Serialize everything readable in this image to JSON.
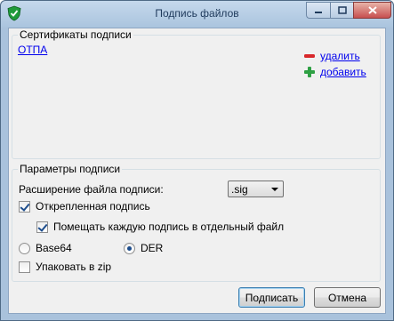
{
  "window": {
    "title": "Подпись файлов"
  },
  "certificates": {
    "legend": "Сертификаты подписи",
    "items": [
      "ОТПА"
    ],
    "remove_label": "удалить",
    "add_label": "добавить"
  },
  "params": {
    "legend": "Параметры подписи",
    "extension_label": "Расширение файла подписи:",
    "extension_value": ".sig",
    "detached_label": "Открепленная подпись",
    "detached_checked": true,
    "separate_label": "Помещать каждую подпись в отдельный файл",
    "separate_checked": true,
    "base64_label": "Base64",
    "der_label": "DER",
    "encoding_selected": "DER",
    "zip_label": "Упаковать в zip",
    "zip_checked": false
  },
  "buttons": {
    "sign_label": "Подписать",
    "cancel_label": "Отмена"
  },
  "colors": {
    "link": "#0000ee",
    "titlebar": "#c5d8ec",
    "remove_icon": "#d8282b",
    "add_icon": "#2ea043"
  }
}
